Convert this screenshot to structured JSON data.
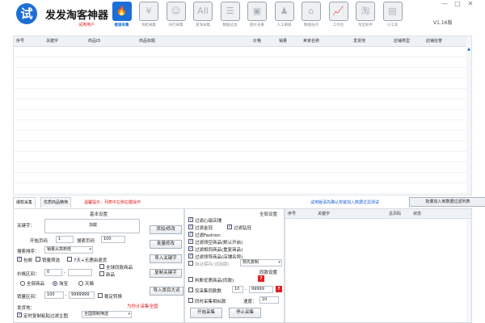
{
  "app": {
    "title": "发发淘客神器",
    "trial_user": "试用用户",
    "logo_char": "试",
    "version": "V1.16版",
    "window_controls": [
      "—",
      "□",
      "✕"
    ]
  },
  "toolbar": [
    {
      "label": "極速采集",
      "icon": "flame-icon",
      "active": true
    },
    {
      "label": "淘抢采集",
      "icon": "yen-icon",
      "active": false
    },
    {
      "label": "同行采集",
      "icon": "user-icon",
      "active": false
    },
    {
      "label": "爱淘采集",
      "icon": "all-icon",
      "active": false
    },
    {
      "label": "数据过滤",
      "icon": "filter-icon",
      "active": false
    },
    {
      "label": "图片去重",
      "icon": "image-icon",
      "active": false
    },
    {
      "label": "人工刷屏",
      "icon": "person-icon",
      "active": false
    },
    {
      "label": "数据站点",
      "icon": "home-icon",
      "active": false
    },
    {
      "label": "工作台",
      "icon": "chart-icon",
      "active": false
    },
    {
      "label": "淘宝助手",
      "icon": "taobao-icon",
      "active": false
    },
    {
      "label": "小工具",
      "icon": "toolbox-icon",
      "active": false
    }
  ],
  "top_grid": {
    "columns": [
      "序号",
      "关键字",
      "商品ID",
      "商品标题",
      "价格",
      "销量",
      "卖家名称",
      "发货地",
      "店铺类型",
      "店铺信誉"
    ]
  },
  "tabs": {
    "items": [
      "爆款采集",
      "优质商品精筛"
    ],
    "tip": "温馨提示：列表中左侧右键操作",
    "fiddler": "试用版请先确认安装加入数据过滤测试",
    "batch_button": "批量加入到数据过滤列表"
  },
  "basic": {
    "title": "基本设置",
    "keyword_label": "关键字：",
    "keyword_value": "加载",
    "start_page_label": "开始页码",
    "start_page_value": "1",
    "search_pages_label": "搜索页码",
    "search_pages_value": "100",
    "sort_label": "搜索排序：",
    "sort_value": "销量从高到低",
    "cb_postage": "包邮",
    "cb_sales_filter": "销量筛选",
    "cb_7day": "7天+无理由退货",
    "cb_same_city": "全球同款商品",
    "cb_new": "新品",
    "price_range_label": "价格区间：",
    "price_min": "0",
    "price_max": "",
    "radio_all": "全部商品",
    "radio_taobao": "淘宝",
    "radio_tmall": "天猫",
    "sales_range_label": "销量区间：",
    "sales_min": "100",
    "sales_max": "9999999",
    "cb_smart": "稳定转换",
    "shipping_label": "发货地：",
    "cb_paste": "定时复制粘贴过滤主图",
    "location_value": "全国限制筛选",
    "timed_red": "为你计采集全国",
    "btn_add_edit": "添加/修改",
    "btn_batch_edit": "批量修改",
    "btn_import_kw": "导入关键字",
    "btn_copy_kw": "复制关键字",
    "btn_import_cat": "导入类目大词"
  },
  "global": {
    "title": "全局设置",
    "cb_filter_mobile": "过滤心级店铺",
    "cb_filter_goldshop": "过滤金冠",
    "cb_filter_brand": "过滤钻冠",
    "cb_filter_fashion": "过滤Fashion",
    "cb_filter_lingkong": "过滤领空商品(默认开启)",
    "cb_filter_title_dup": "过滤相同商品(重复商品)",
    "cb_filter_shopname": "过滤领导商品(店铺名称)",
    "cb_auto": "自动保存(试用版)",
    "auto_select": "预先复制",
    "sub_title": "同款设置",
    "cb_judge": "判断优质商品(同款)",
    "cb_range": "仅采集同款数",
    "range_min": "10",
    "range_max": "99999",
    "cb_sync": "同时采集相似款",
    "speed_label": "速度：",
    "speed_value": "10",
    "btn_start": "开始采集",
    "btn_stop": "停止采集"
  },
  "bottom_grid": {
    "columns": [
      "序号",
      "关键字",
      "总页码",
      "状态"
    ]
  }
}
